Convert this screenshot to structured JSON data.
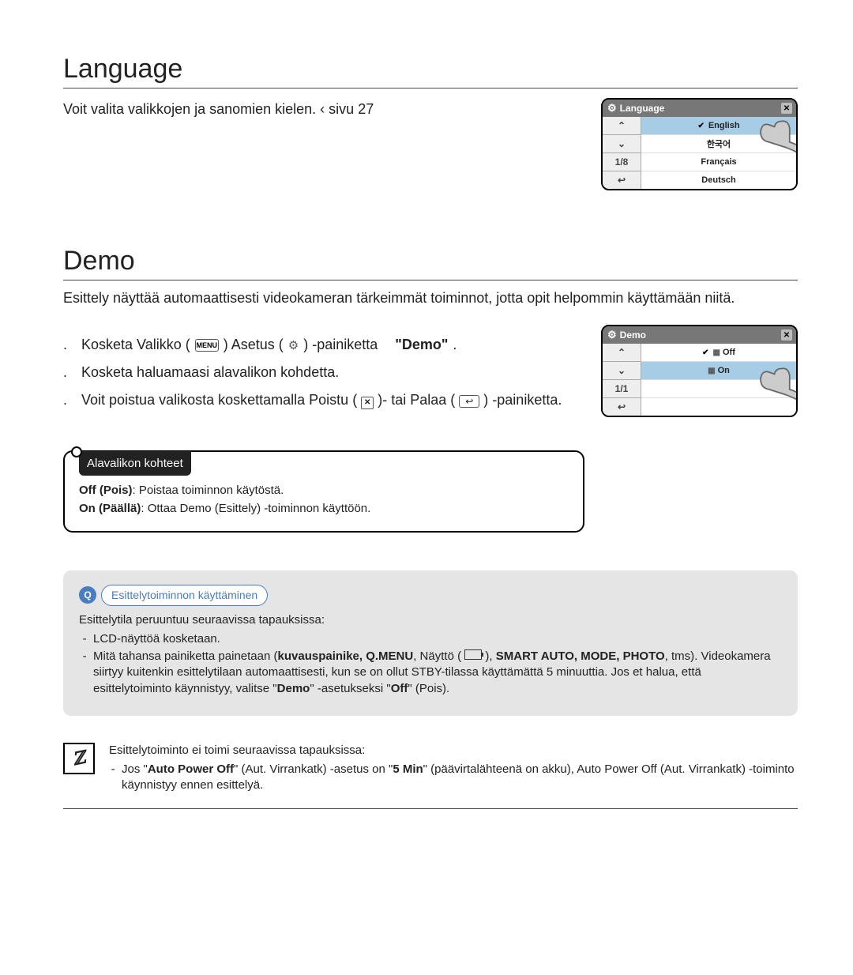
{
  "language_section": {
    "title": "Language",
    "desc_prefix": "Voit valita valikkojen ja sanomien kielen.  ‹ sivu ",
    "page_ref": "27",
    "screen_title": "Language",
    "options": [
      "English",
      "한국어",
      "Français",
      "Deutsch"
    ],
    "page_indicator": "1/8"
  },
  "demo_section": {
    "title": "Demo",
    "desc": "Esittely näyttää automaattisesti videokameran tärkeimmät toiminnot, jotta opit helpommin käyttämään niitä.",
    "step1_a": "Kosketa Valikko (",
    "step1_menu_label": "MENU",
    "step1_b": ")      Asetus (",
    "step1_c": ") -painiketta",
    "step1_d": "\"Demo\"",
    "step1_dot": ".",
    "step2": "Kosketa haluamaasi alavalikon kohdetta.",
    "step3_a": "Voit poistua valikosta koskettamalla Poistu (",
    "step3_b": ")- tai Palaa (",
    "step3_c": ") -painiketta.",
    "screen_title": "Demo",
    "options_off": "Off",
    "options_on": "On",
    "page_indicator": "1/1"
  },
  "submenu": {
    "header": "Alavalikon kohteet",
    "line1_bold": "Off (Pois)",
    "line1_rest": ": Poistaa toiminnon käytöstä.",
    "line2_bold": "On (Päällä)",
    "line2_rest": ": Ottaa Demo (Esittely) -toiminnon käyttöön."
  },
  "tips": {
    "title": "Esittelytoiminnon käyttäminen",
    "intro": "Esittelytila peruuntuu seuraavissa tapauksissa:",
    "bullet1": "LCD-näyttöä kosketaan.",
    "bullet2_a": "Mitä tahansa painiketta painetaan (",
    "bullet2_bold": "kuvauspainike, Q.MENU",
    "bullet2_b": ", Näyttö (",
    "bullet2_c": "), ",
    "bullet2_bold2": "SMART AUTO, MODE, PHOTO",
    "bullet2_d": ", tms). Videokamera siirtyy kuitenkin esittelytilaan automaattisesti, kun se on ollut STBY-tilassa käyttämättä 5 minuuttia. Jos et halua, että esittelytoiminto käynnistyy, valitse \"",
    "bullet2_demo": "Demo",
    "bullet2_e": "\" -asetukseksi \"",
    "bullet2_off": "Off",
    "bullet2_f": "\" (Pois)."
  },
  "note": {
    "intro": "Esittelytoiminto ei toimi seuraavissa tapauksissa:",
    "b1_a": "Jos \"",
    "b1_bold1": "Auto Power Off",
    "b1_b": "\" (Aut. Virrankatk) -asetus on \"",
    "b1_bold2": "5 Min",
    "b1_c": "\" (päävirtalähteenä on akku), Auto Power Off (Aut. Virrankatk) -toiminto käynnistyy ennen esittelyä."
  },
  "icons": {
    "gear": "⚙",
    "close": "✕",
    "return": "↩",
    "up": "⌃",
    "down": "⌄"
  }
}
